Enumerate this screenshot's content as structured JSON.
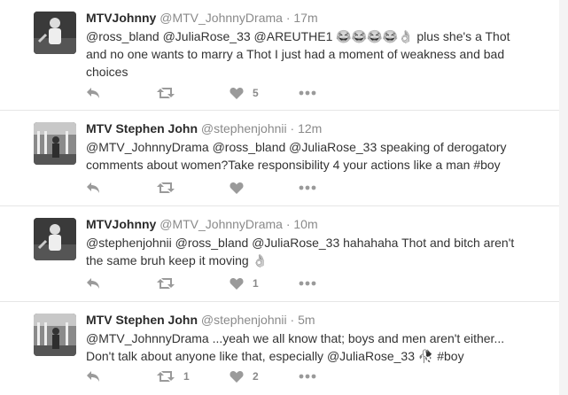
{
  "tweets": [
    {
      "name": "MTVJohnny",
      "handle": "@MTV_JohnnyDrama",
      "dot": "·",
      "time": "17m",
      "lines": [
        "@ross_bland @JuliaRose_33 @AREUTHE1 😂😂😂😂👌 plus she's a Thot",
        "and no one wants to marry a Thot I just had a moment of weakness and bad",
        "choices"
      ],
      "likes": "5",
      "retweets": ""
    },
    {
      "name": "MTV Stephen John",
      "handle": "@stephenjohnii",
      "dot": "·",
      "time": "12m",
      "lines": [
        "@MTV_JohnnyDrama @ross_bland @JuliaRose_33  speaking of derogatory",
        "comments about women?Take responsibility 4 your actions like a man #boy"
      ],
      "likes": "",
      "retweets": ""
    },
    {
      "name": "MTVJohnny",
      "handle": "@MTV_JohnnyDrama",
      "dot": "·",
      "time": "10m",
      "lines": [
        "@stephenjohnii @ross_bland @JuliaRose_33 hahahaha Thot and bitch aren't",
        "the same bruh keep it moving 👌"
      ],
      "likes": "1",
      "retweets": ""
    },
    {
      "name": "MTV Stephen John",
      "handle": "@stephenjohnii",
      "dot": "·",
      "time": "5m",
      "lines": [
        "@MTV_JohnnyDrama ...yeah we all know that; boys and men aren't either...",
        "Don't talk about anyone like that, especially @JuliaRose_33 🥀 #boy"
      ],
      "likes": "2",
      "retweets": "1"
    }
  ]
}
